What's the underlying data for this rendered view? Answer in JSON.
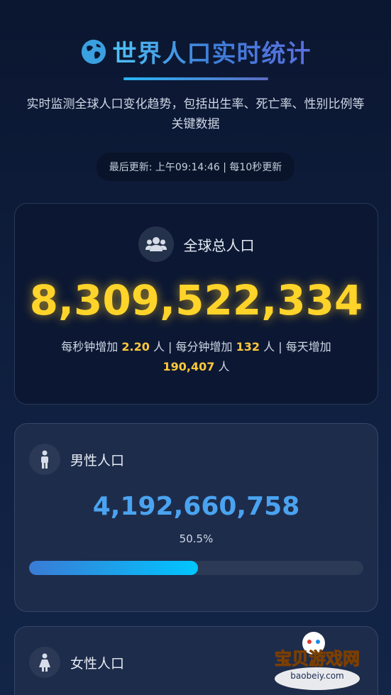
{
  "header": {
    "icon": "globe-icon",
    "title": "世界人口实时统计",
    "subtitle": "实时监测全球人口变化趋势，包括出生率、死亡率、性别比例等关键数据",
    "update_text": "最后更新: 上午09:14:46 | 每10秒更新"
  },
  "total": {
    "icon": "users-icon",
    "label": "全球总人口",
    "value": "8,309,522,334",
    "rate_prefix_sec": "每秒钟增加",
    "rate_sec": "2.20",
    "rate_unit_sec": "人 | 每分钟增加",
    "rate_min": "132",
    "rate_unit_min": "人 | 每天增加",
    "rate_day": "190,407",
    "rate_unit_day": "人"
  },
  "male": {
    "icon": "male-icon",
    "label": "男性人口",
    "value": "4,192,660,758",
    "percent_text": "50.5%",
    "percent": 50.5
  },
  "female": {
    "icon": "female-icon",
    "label": "女性人口"
  },
  "watermark": {
    "text": "宝贝游戏网",
    "url": "baobeiy.com"
  },
  "colors": {
    "accent_gold": "#ffd42a",
    "accent_blue": "#4aa3f0"
  }
}
